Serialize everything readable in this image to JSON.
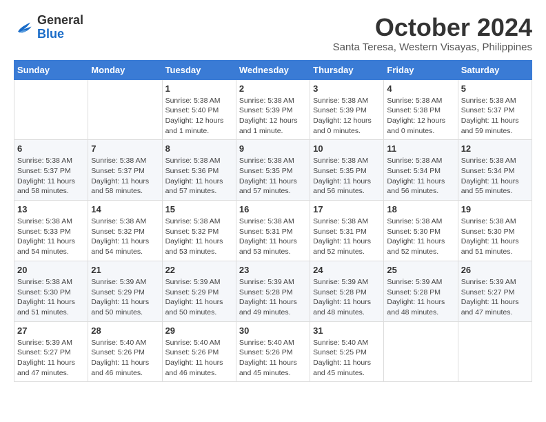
{
  "header": {
    "logo_general": "General",
    "logo_blue": "Blue",
    "month_title": "October 2024",
    "location": "Santa Teresa, Western Visayas, Philippines"
  },
  "days_of_week": [
    "Sunday",
    "Monday",
    "Tuesday",
    "Wednesday",
    "Thursday",
    "Friday",
    "Saturday"
  ],
  "weeks": [
    [
      {
        "day": "",
        "info": ""
      },
      {
        "day": "",
        "info": ""
      },
      {
        "day": "1",
        "info": "Sunrise: 5:38 AM\nSunset: 5:40 PM\nDaylight: 12 hours\nand 1 minute."
      },
      {
        "day": "2",
        "info": "Sunrise: 5:38 AM\nSunset: 5:39 PM\nDaylight: 12 hours\nand 1 minute."
      },
      {
        "day": "3",
        "info": "Sunrise: 5:38 AM\nSunset: 5:39 PM\nDaylight: 12 hours\nand 0 minutes."
      },
      {
        "day": "4",
        "info": "Sunrise: 5:38 AM\nSunset: 5:38 PM\nDaylight: 12 hours\nand 0 minutes."
      },
      {
        "day": "5",
        "info": "Sunrise: 5:38 AM\nSunset: 5:37 PM\nDaylight: 11 hours\nand 59 minutes."
      }
    ],
    [
      {
        "day": "6",
        "info": "Sunrise: 5:38 AM\nSunset: 5:37 PM\nDaylight: 11 hours\nand 58 minutes."
      },
      {
        "day": "7",
        "info": "Sunrise: 5:38 AM\nSunset: 5:37 PM\nDaylight: 11 hours\nand 58 minutes."
      },
      {
        "day": "8",
        "info": "Sunrise: 5:38 AM\nSunset: 5:36 PM\nDaylight: 11 hours\nand 57 minutes."
      },
      {
        "day": "9",
        "info": "Sunrise: 5:38 AM\nSunset: 5:35 PM\nDaylight: 11 hours\nand 57 minutes."
      },
      {
        "day": "10",
        "info": "Sunrise: 5:38 AM\nSunset: 5:35 PM\nDaylight: 11 hours\nand 56 minutes."
      },
      {
        "day": "11",
        "info": "Sunrise: 5:38 AM\nSunset: 5:34 PM\nDaylight: 11 hours\nand 56 minutes."
      },
      {
        "day": "12",
        "info": "Sunrise: 5:38 AM\nSunset: 5:34 PM\nDaylight: 11 hours\nand 55 minutes."
      }
    ],
    [
      {
        "day": "13",
        "info": "Sunrise: 5:38 AM\nSunset: 5:33 PM\nDaylight: 11 hours\nand 54 minutes."
      },
      {
        "day": "14",
        "info": "Sunrise: 5:38 AM\nSunset: 5:32 PM\nDaylight: 11 hours\nand 54 minutes."
      },
      {
        "day": "15",
        "info": "Sunrise: 5:38 AM\nSunset: 5:32 PM\nDaylight: 11 hours\nand 53 minutes."
      },
      {
        "day": "16",
        "info": "Sunrise: 5:38 AM\nSunset: 5:31 PM\nDaylight: 11 hours\nand 53 minutes."
      },
      {
        "day": "17",
        "info": "Sunrise: 5:38 AM\nSunset: 5:31 PM\nDaylight: 11 hours\nand 52 minutes."
      },
      {
        "day": "18",
        "info": "Sunrise: 5:38 AM\nSunset: 5:30 PM\nDaylight: 11 hours\nand 52 minutes."
      },
      {
        "day": "19",
        "info": "Sunrise: 5:38 AM\nSunset: 5:30 PM\nDaylight: 11 hours\nand 51 minutes."
      }
    ],
    [
      {
        "day": "20",
        "info": "Sunrise: 5:38 AM\nSunset: 5:30 PM\nDaylight: 11 hours\nand 51 minutes."
      },
      {
        "day": "21",
        "info": "Sunrise: 5:39 AM\nSunset: 5:29 PM\nDaylight: 11 hours\nand 50 minutes."
      },
      {
        "day": "22",
        "info": "Sunrise: 5:39 AM\nSunset: 5:29 PM\nDaylight: 11 hours\nand 50 minutes."
      },
      {
        "day": "23",
        "info": "Sunrise: 5:39 AM\nSunset: 5:28 PM\nDaylight: 11 hours\nand 49 minutes."
      },
      {
        "day": "24",
        "info": "Sunrise: 5:39 AM\nSunset: 5:28 PM\nDaylight: 11 hours\nand 48 minutes."
      },
      {
        "day": "25",
        "info": "Sunrise: 5:39 AM\nSunset: 5:28 PM\nDaylight: 11 hours\nand 48 minutes."
      },
      {
        "day": "26",
        "info": "Sunrise: 5:39 AM\nSunset: 5:27 PM\nDaylight: 11 hours\nand 47 minutes."
      }
    ],
    [
      {
        "day": "27",
        "info": "Sunrise: 5:39 AM\nSunset: 5:27 PM\nDaylight: 11 hours\nand 47 minutes."
      },
      {
        "day": "28",
        "info": "Sunrise: 5:40 AM\nSunset: 5:26 PM\nDaylight: 11 hours\nand 46 minutes."
      },
      {
        "day": "29",
        "info": "Sunrise: 5:40 AM\nSunset: 5:26 PM\nDaylight: 11 hours\nand 46 minutes."
      },
      {
        "day": "30",
        "info": "Sunrise: 5:40 AM\nSunset: 5:26 PM\nDaylight: 11 hours\nand 45 minutes."
      },
      {
        "day": "31",
        "info": "Sunrise: 5:40 AM\nSunset: 5:25 PM\nDaylight: 11 hours\nand 45 minutes."
      },
      {
        "day": "",
        "info": ""
      },
      {
        "day": "",
        "info": ""
      }
    ]
  ]
}
